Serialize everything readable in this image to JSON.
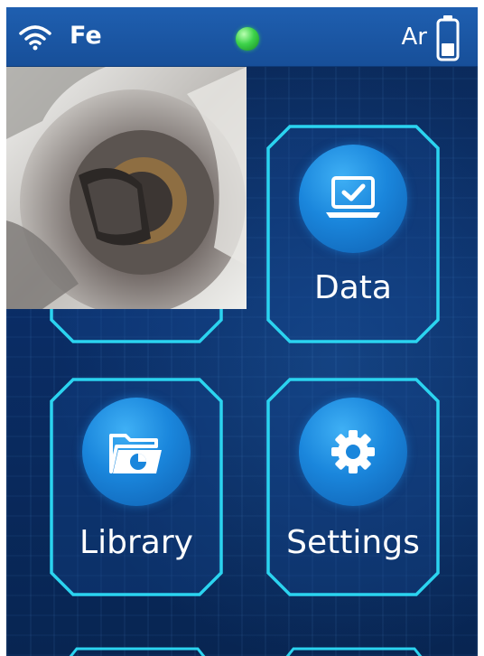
{
  "status_bar": {
    "element": "Fe",
    "gas": "Ar",
    "wifi_icon": "wifi-icon",
    "battery_icon": "battery-icon",
    "led_color": "#3dd34a"
  },
  "menu": {
    "tiles": [
      {
        "label": "Data",
        "icon": "laptop-check-icon"
      },
      {
        "label": "Library",
        "icon": "folder-chart-icon"
      },
      {
        "label": "Settings",
        "icon": "gear-icon"
      }
    ]
  },
  "colors": {
    "accent": "#2bd4f0",
    "tile_circle": "#1a86dc",
    "status_bar": "#1f5fb0",
    "background": "#0a2d66"
  }
}
